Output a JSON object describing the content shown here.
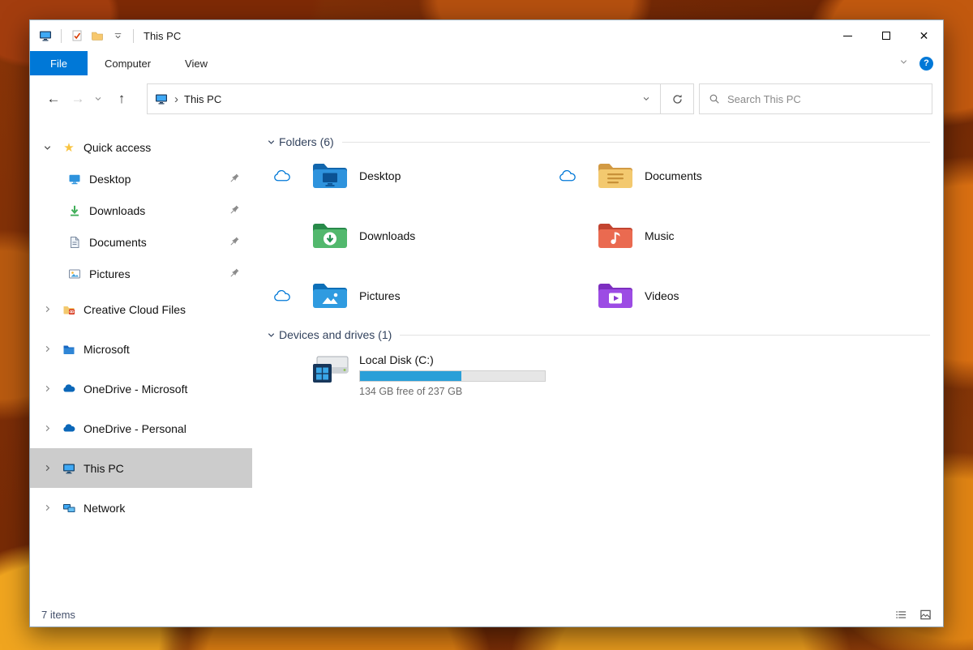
{
  "colors": {
    "accent": "#0078d7",
    "file_tab": "#0078d7",
    "sidebar_selection": "#cccccc",
    "disk_bar_fill": "#2a9fd8",
    "section_title": "#33435e"
  },
  "titlebar": {
    "title": "This PC"
  },
  "icons": {
    "back": "←",
    "forward": "→",
    "up": "↑",
    "breadcrumb_chevron": "›",
    "star": "★",
    "close": "✕",
    "help": "?"
  },
  "ribbon": {
    "file_tab": "File",
    "computer_tab": "Computer",
    "view_tab": "View",
    "help_glyph": "?"
  },
  "navigation": {
    "address": "This PC",
    "search_placeholder": "Search This PC"
  },
  "sidebar": {
    "quick_access_label": "Quick access",
    "pinned_items": [
      {
        "label": "Desktop",
        "pinned": true
      },
      {
        "label": "Downloads",
        "pinned": true
      },
      {
        "label": "Documents",
        "pinned": true
      },
      {
        "label": "Pictures",
        "pinned": true
      }
    ],
    "tree_items": [
      {
        "label": "Creative Cloud Files",
        "selected": false
      },
      {
        "label": "Microsoft",
        "selected": false
      },
      {
        "label": "OneDrive - Microsoft",
        "selected": false
      },
      {
        "label": "OneDrive - Personal",
        "selected": false
      },
      {
        "label": "This PC",
        "selected": true
      },
      {
        "label": "Network",
        "selected": false
      }
    ]
  },
  "content": {
    "folders_title": "Folders (6)",
    "tiles": [
      {
        "label": "Desktop",
        "cloud": true
      },
      {
        "label": "Documents",
        "cloud": true
      },
      {
        "label": "Downloads",
        "cloud": false
      },
      {
        "label": "Music",
        "cloud": false
      },
      {
        "label": "Pictures",
        "cloud": true
      },
      {
        "label": "Videos",
        "cloud": false
      }
    ],
    "drives_title": "Devices and drives (1)",
    "drive": {
      "label": "Local Disk (C:)",
      "capacity": "134 GB free of 237 GB",
      "bar_percent": 55
    }
  },
  "statusbar": {
    "items_text": "7 items"
  }
}
